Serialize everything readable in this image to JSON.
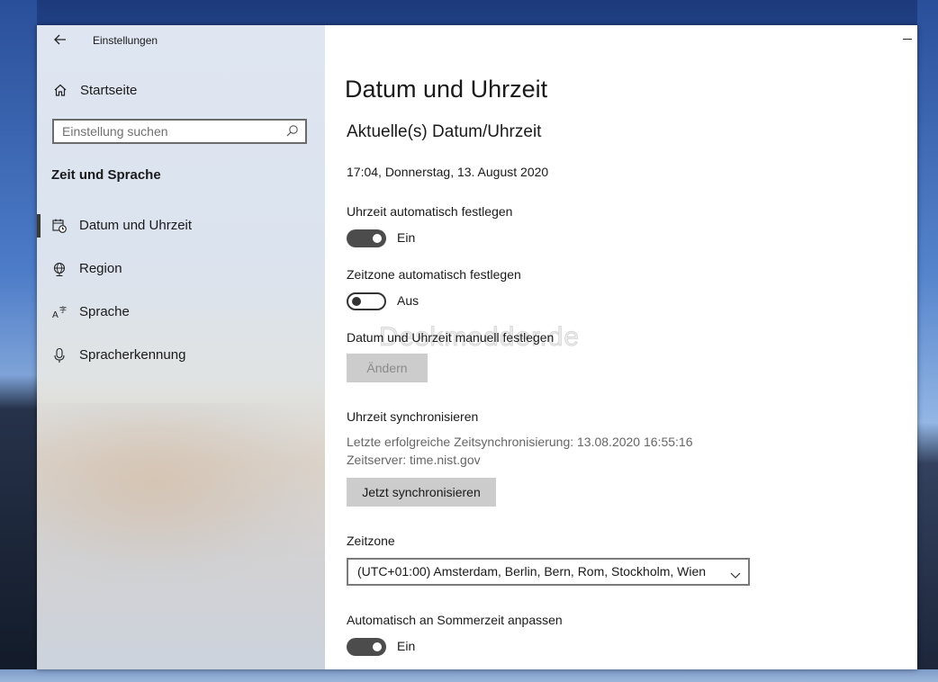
{
  "window": {
    "app_title": "Einstellungen"
  },
  "sidebar": {
    "home_label": "Startseite",
    "search_placeholder": "Einstellung suchen",
    "section_title": "Zeit und Sprache",
    "items": [
      {
        "label": "Datum und Uhrzeit",
        "icon": "calendar-clock-icon",
        "selected": true
      },
      {
        "label": "Region",
        "icon": "globe-icon",
        "selected": false
      },
      {
        "label": "Sprache",
        "icon": "language-icon",
        "selected": false
      },
      {
        "label": "Spracherkennung",
        "icon": "microphone-icon",
        "selected": false
      }
    ]
  },
  "main": {
    "page_title": "Datum und Uhrzeit",
    "section_title": "Aktuelle(s) Datum/Uhrzeit",
    "current_datetime": "17:04, Donnerstag, 13. August 2020",
    "auto_time": {
      "label": "Uhrzeit automatisch festlegen",
      "state": "Ein",
      "on": true
    },
    "auto_timezone": {
      "label": "Zeitzone automatisch festlegen",
      "state": "Aus",
      "on": false
    },
    "manual": {
      "label": "Datum und Uhrzeit manuell festlegen",
      "button": "Ändern"
    },
    "sync": {
      "title": "Uhrzeit synchronisieren",
      "last_sync": "Letzte erfolgreiche Zeitsynchronisierung: 13.08.2020 16:55:16",
      "server": "Zeitserver: time.nist.gov",
      "button": "Jetzt synchronisieren"
    },
    "timezone": {
      "label": "Zeitzone",
      "value": "(UTC+01:00) Amsterdam, Berlin, Bern, Rom, Stockholm, Wien"
    },
    "dst": {
      "label": "Automatisch an Sommerzeit anpassen",
      "state": "Ein",
      "on": true
    },
    "watermark": "Deskmodder.de"
  },
  "colors": {
    "toggle_on": "#4c4c4c",
    "button_bg": "#cccccc",
    "sidebar_indicator": "#3a3a3a"
  }
}
